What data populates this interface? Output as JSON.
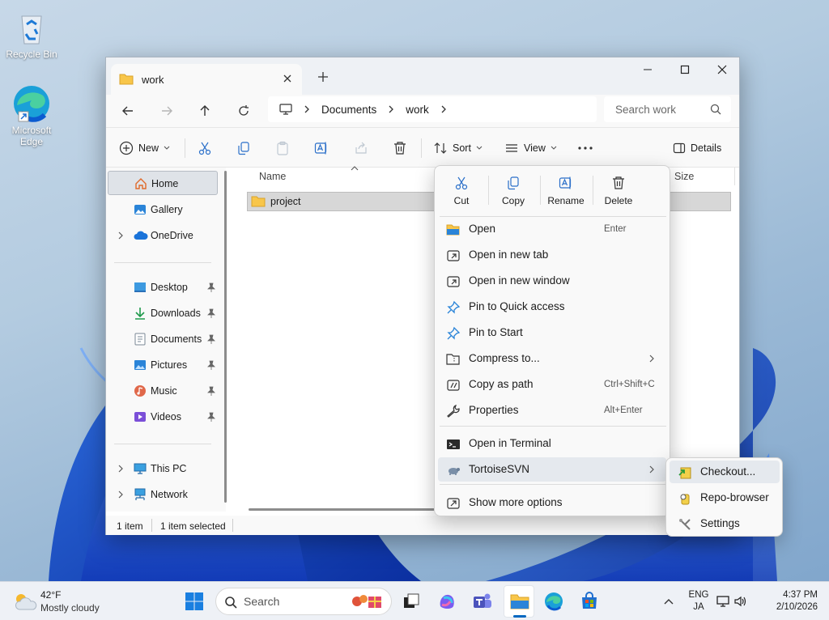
{
  "desktop": {
    "icons": [
      {
        "label": "Recycle Bin"
      },
      {
        "label": "Microsoft Edge"
      }
    ]
  },
  "window": {
    "tab_title": "work",
    "breadcrumb": [
      "Documents",
      "work"
    ],
    "search_placeholder": "Search work",
    "toolbar": {
      "new_label": "New",
      "sort_label": "Sort",
      "view_label": "View",
      "details_label": "Details"
    },
    "sidebar": {
      "items": [
        {
          "label": "Home"
        },
        {
          "label": "Gallery"
        },
        {
          "label": "OneDrive"
        },
        {
          "label": "Desktop"
        },
        {
          "label": "Downloads"
        },
        {
          "label": "Documents"
        },
        {
          "label": "Pictures"
        },
        {
          "label": "Music"
        },
        {
          "label": "Videos"
        },
        {
          "label": "This PC"
        },
        {
          "label": "Network"
        }
      ]
    },
    "columns": {
      "name": "Name",
      "size": "Size"
    },
    "files": [
      {
        "name": "project"
      }
    ],
    "status": {
      "count": "1 item",
      "selected": "1 item selected"
    }
  },
  "context_menu": {
    "actions": [
      {
        "label": "Cut"
      },
      {
        "label": "Copy"
      },
      {
        "label": "Rename"
      },
      {
        "label": "Delete"
      }
    ],
    "items": [
      {
        "label": "Open",
        "shortcut": "Enter"
      },
      {
        "label": "Open in new tab"
      },
      {
        "label": "Open in new window"
      },
      {
        "label": "Pin to Quick access"
      },
      {
        "label": "Pin to Start"
      },
      {
        "label": "Compress to..."
      },
      {
        "label": "Copy as path",
        "shortcut": "Ctrl+Shift+C"
      },
      {
        "label": "Properties",
        "shortcut": "Alt+Enter"
      },
      {
        "label": "Open in Terminal"
      },
      {
        "label": "TortoiseSVN"
      },
      {
        "label": "Show more options"
      }
    ],
    "submenu": [
      {
        "label": "Checkout..."
      },
      {
        "label": "Repo-browser"
      },
      {
        "label": "Settings"
      }
    ]
  },
  "taskbar": {
    "weather_temp": "42°F",
    "weather_desc": "Mostly cloudy",
    "search_label": "Search",
    "lang_top": "ENG",
    "lang_bottom": "JA",
    "time": "4:37 PM",
    "date": "2/10/2026"
  },
  "colors": {
    "accent": "#0067c0",
    "folder": "#f8c64a",
    "selection": "#d7d7d7"
  }
}
